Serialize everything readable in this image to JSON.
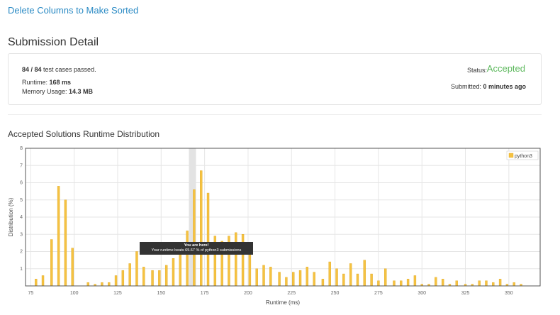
{
  "problem": {
    "title": "Delete Columns to Make Sorted"
  },
  "submission": {
    "heading": "Submission Detail",
    "testcases_passed": "84 / 84",
    "testcases_suffix": " test cases passed.",
    "runtime_label": "Runtime: ",
    "runtime_value": "168 ms",
    "memory_label": "Memory Usage: ",
    "memory_value": "14.3 MB",
    "status_label": "Status:",
    "status_value": "Accepted",
    "submitted_label": "Submitted: ",
    "submitted_value": "0 minutes ago"
  },
  "distribution": {
    "heading": "Accepted Solutions Runtime Distribution"
  },
  "tooltip": {
    "line1": "You are here!",
    "line2": "Your runtime beats 65.67 % of python3 submissions"
  },
  "colors": {
    "bar": "#f5c242",
    "bar_stroke": "#e0a820",
    "accepted": "#5cb85c",
    "link": "#2a8ac4",
    "highlight": "#e3e3e3"
  },
  "chart_data": {
    "type": "bar",
    "xlabel": "Runtime (ms)",
    "ylabel": "Distribution (%)",
    "xlim": [
      72,
      368
    ],
    "ylim": [
      0,
      8
    ],
    "xticks": [
      75,
      100,
      125,
      150,
      175,
      200,
      225,
      250,
      275,
      300,
      325,
      350
    ],
    "yticks": [
      1,
      2,
      3,
      4,
      5,
      6,
      7,
      8
    ],
    "highlight_x": 168,
    "legend": {
      "position": "top-right",
      "entries": [
        "python3"
      ]
    },
    "series": [
      {
        "name": "python3",
        "x": [
          78,
          82,
          87,
          91,
          95,
          99,
          108,
          112,
          116,
          120,
          124,
          128,
          132,
          136,
          140,
          145,
          149,
          153,
          157,
          161,
          165,
          169,
          173,
          177,
          181,
          185,
          189,
          193,
          197,
          201,
          205,
          209,
          213,
          218,
          222,
          226,
          230,
          234,
          238,
          243,
          247,
          251,
          255,
          259,
          263,
          267,
          271,
          275,
          279,
          284,
          288,
          292,
          296,
          300,
          304,
          308,
          312,
          316,
          320,
          325,
          329,
          333,
          337,
          341,
          345,
          349,
          353,
          357
        ],
        "values": [
          0.4,
          0.6,
          2.7,
          5.8,
          5.0,
          2.2,
          0.2,
          0.1,
          0.2,
          0.2,
          0.6,
          0.9,
          1.3,
          2.0,
          1.1,
          0.9,
          0.9,
          1.2,
          1.6,
          1.9,
          3.2,
          5.6,
          6.7,
          5.4,
          2.9,
          2.6,
          2.9,
          3.1,
          3.0,
          2.5,
          1.0,
          1.2,
          1.1,
          0.8,
          0.5,
          0.8,
          0.9,
          1.1,
          0.8,
          0.4,
          1.4,
          1.0,
          0.7,
          1.3,
          0.7,
          1.5,
          0.7,
          0.3,
          1.0,
          0.3,
          0.3,
          0.4,
          0.6,
          0.1,
          0.1,
          0.5,
          0.4,
          0.1,
          0.3,
          0.1,
          0.1,
          0.3,
          0.3,
          0.2,
          0.4,
          0.1,
          0.2,
          0.1
        ]
      }
    ]
  }
}
